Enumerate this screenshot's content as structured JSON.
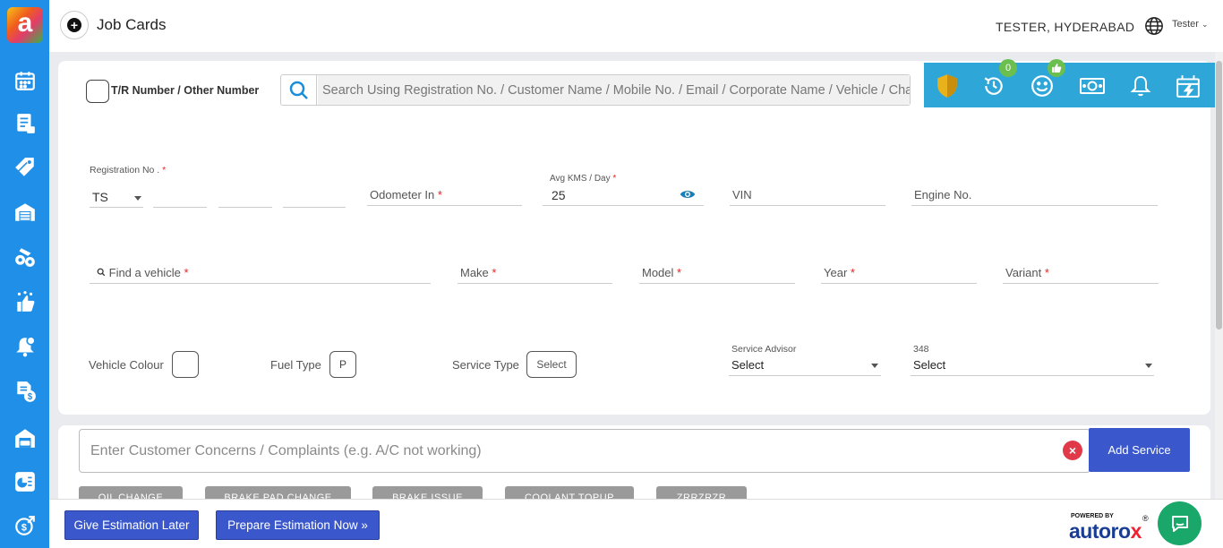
{
  "header": {
    "title": "Job Cards",
    "user_location": "TESTER, HYDERABAD",
    "user_name": "Tester"
  },
  "search": {
    "checkbox_label": "T/R Number / Other Number",
    "placeholder": "Search Using Registration No. / Customer Name / Mobile No. / Email / Corporate Name / Vehicle / Chassis No."
  },
  "toolbar": {
    "history_badge": "0",
    "icons": [
      "shield-icon",
      "history-icon",
      "smiley-icon",
      "cash-icon",
      "bell-icon",
      "ev-charging-icon"
    ]
  },
  "form": {
    "registration_label": "Registration No .",
    "registration_state": "TS",
    "odometer_label": "Odometer In",
    "avg_kms_label": "Avg KMS / Day",
    "avg_kms_value": "25",
    "vin_label": "VIN",
    "engine_label": "Engine No.",
    "find_vehicle_label": "Find a vehicle",
    "make_label": "Make",
    "model_label": "Model",
    "year_label": "Year",
    "variant_label": "Variant",
    "vehicle_colour_label": "Vehicle Colour",
    "fuel_type_label": "Fuel Type",
    "fuel_type_value": "P",
    "service_type_label": "Service Type",
    "service_type_value": "Select",
    "service_advisor_label": "Service Advisor",
    "service_advisor_value": "Select",
    "field_348_label": "348",
    "field_348_value": "Select",
    "required_mark": "*"
  },
  "concerns": {
    "placeholder": "Enter Customer Concerns / Complaints (e.g. A/C not working)",
    "add_service_label": "Add Service",
    "chips": [
      "OIL CHANGE",
      "BRAKE PAD CHANGE",
      "BRAKE ISSUE",
      "COOLANT TOPUP",
      "ZRRZRZR"
    ]
  },
  "footer": {
    "give_estimation_label": "Give Estimation Later",
    "prepare_estimation_label": "Prepare Estimation Now",
    "prepare_estimation_icon": "»",
    "powered_by": "POWERED BY",
    "brand_a": "autoro",
    "brand_b": "x",
    "registered": "®"
  },
  "sidebar": {
    "logo_letter": "a",
    "items": [
      "calendar-icon",
      "invoice-icon",
      "tag-icon",
      "warehouse-icon",
      "parts-icon",
      "rating-icon",
      "notification-icon",
      "billing-icon",
      "garage-icon",
      "report-icon",
      "payment-icon"
    ]
  },
  "colors": {
    "sidebar": "#1f8fe8",
    "toolbar": "#2fa6d8",
    "primary_button": "#3a58cc",
    "badge": "#6bbf4e",
    "chat": "#1aa86a",
    "required": "#ee2222"
  }
}
